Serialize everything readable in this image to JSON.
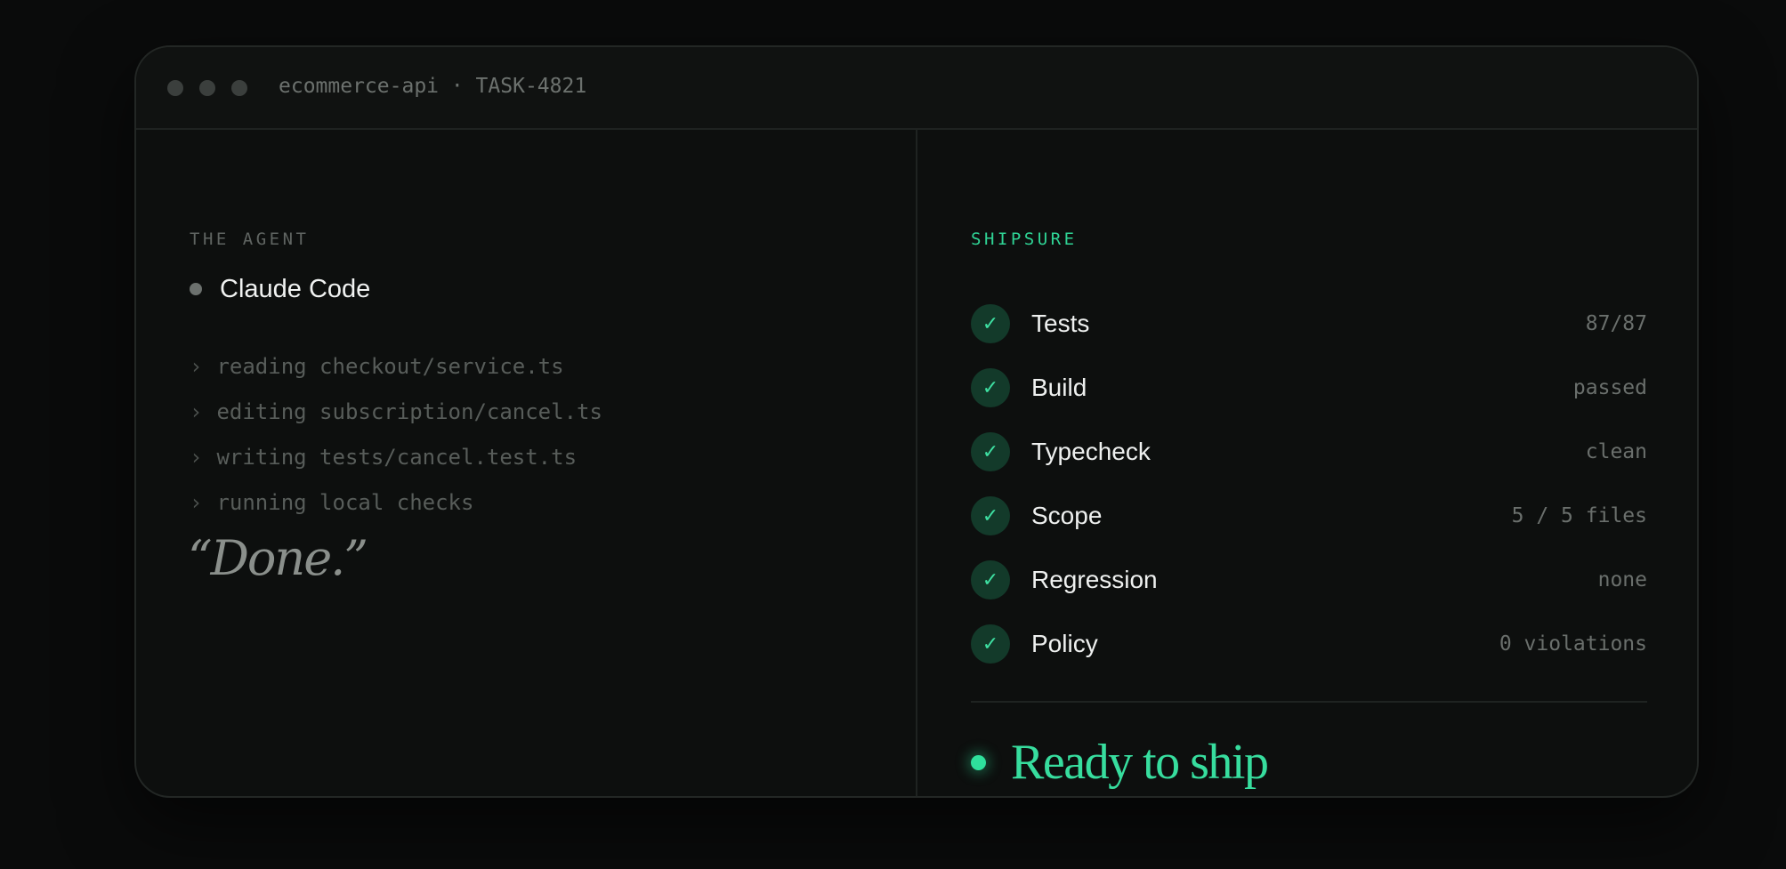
{
  "window": {
    "title": "ecommerce-api · TASK-4821"
  },
  "agent_panel": {
    "section_label": "THE AGENT",
    "agent_name": "Claude Code",
    "log": [
      {
        "prefix": "›",
        "text": "reading checkout/service.ts"
      },
      {
        "prefix": "›",
        "text": "editing subscription/cancel.ts"
      },
      {
        "prefix": "›",
        "text": "writing tests/cancel.test.ts"
      },
      {
        "prefix": "›",
        "text": "running local checks"
      }
    ],
    "quote": "“Done.”"
  },
  "shipsure_panel": {
    "section_label": "SHIPSURE",
    "checks": [
      {
        "icon": "check-icon",
        "glyph": "✓",
        "label": "Tests",
        "value": "87/87"
      },
      {
        "icon": "check-icon",
        "glyph": "✓",
        "label": "Build",
        "value": "passed"
      },
      {
        "icon": "check-icon",
        "glyph": "✓",
        "label": "Typecheck",
        "value": "clean"
      },
      {
        "icon": "check-icon",
        "glyph": "✓",
        "label": "Scope",
        "value": "5 / 5 files"
      },
      {
        "icon": "check-icon",
        "glyph": "✓",
        "label": "Regression",
        "value": "none"
      },
      {
        "icon": "check-icon",
        "glyph": "✓",
        "label": "Policy",
        "value": "0 violations"
      }
    ],
    "status": "Ready to ship"
  },
  "colors": {
    "accent": "#2fd495",
    "background": "#0a0b0b",
    "panel": "#0d0f0e",
    "check_badge": "#133a2a"
  }
}
